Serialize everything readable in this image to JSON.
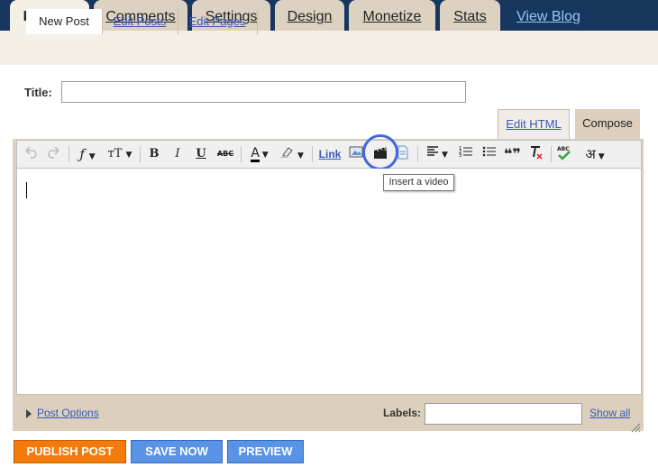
{
  "main_tabs": [
    {
      "label": "Posting",
      "active": true
    },
    {
      "label": "Comments",
      "active": false
    },
    {
      "label": "Settings",
      "active": false
    },
    {
      "label": "Design",
      "active": false
    },
    {
      "label": "Monetize",
      "active": false
    },
    {
      "label": "Stats",
      "active": false
    }
  ],
  "view_blog_label": "View Blog",
  "sub_tabs": [
    {
      "label": "New Post",
      "active": true
    },
    {
      "label": "Edit Posts",
      "active": false
    },
    {
      "label": "Edit Pages",
      "active": false
    }
  ],
  "title_field": {
    "label": "Title:",
    "value": ""
  },
  "mode_tabs": {
    "edit_html": "Edit HTML",
    "compose": "Compose"
  },
  "toolbar": {
    "items": [
      "undo-icon",
      "redo-icon",
      "font-icon",
      "font-size-icon",
      "bold-icon",
      "italic-icon",
      "underline-icon",
      "strikethrough-icon",
      "text-color-icon",
      "highlight-icon",
      "link",
      "insert-image-icon",
      "insert-video-icon",
      "insert-jump-break-icon",
      "align-icon",
      "numbered-list-icon",
      "bulleted-list-icon",
      "blockquote-icon",
      "remove-formatting-icon",
      "spellcheck-icon",
      "transliteration-icon"
    ],
    "link_label": "Link",
    "bold_glyph": "B",
    "italic_glyph": "I",
    "underline_glyph": "U",
    "strike_glyph": "ABC",
    "color_glyph": "A",
    "quote_glyph": "❝❞",
    "spell_glyph": "ABC",
    "translit_glyph": "अ",
    "tooltip": "Insert a video"
  },
  "editor": {
    "content": ""
  },
  "post_options_label": "Post Options",
  "labels_field": {
    "label": "Labels:",
    "value": ""
  },
  "show_all_label": "Show all",
  "buttons": {
    "publish": "PUBLISH POST",
    "save": "SAVE NOW",
    "preview": "PREVIEW"
  },
  "colors": {
    "header_bg": "#16365e",
    "tab_bg": "#ddd2c2",
    "active_bg": "#f4efe7",
    "publish": "#f47a0a",
    "save": "#5a93e5",
    "link": "#3a57b8"
  }
}
